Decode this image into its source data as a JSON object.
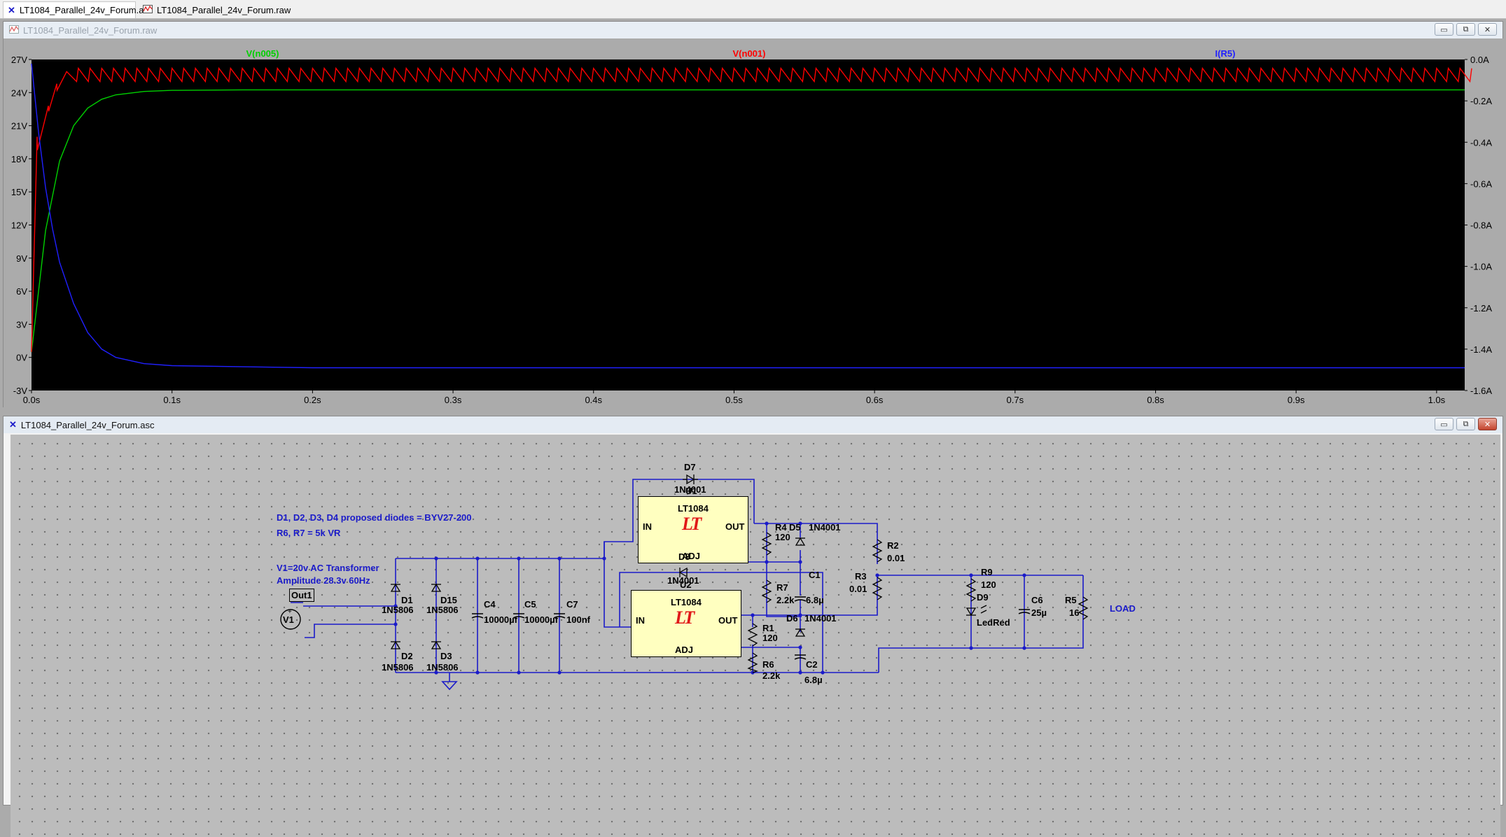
{
  "tabs": [
    {
      "label": "LT1084_Parallel_24v_Forum.asc",
      "icon": "schematic-icon",
      "active": true
    },
    {
      "label": "LT1084_Parallel_24v_Forum.raw",
      "icon": "waveform-icon",
      "active": false
    }
  ],
  "waveform_window": {
    "title": "LT1084_Parallel_24v_Forum.raw",
    "icon": "waveform-icon"
  },
  "schematic_window": {
    "title": "LT1084_Parallel_24v_Forum.asc",
    "icon": "schematic-icon"
  },
  "window_buttons": {
    "minimize": "▭",
    "restore": "⧉",
    "close": "✕"
  },
  "colors": {
    "plot_bg": "#000000",
    "v_n005": "#00d000",
    "v_n001": "#ff0000",
    "i_r5": "#2020ff",
    "wire": "#1b1bc9",
    "ic_fill": "#ffffc0"
  },
  "chart_data": {
    "type": "line",
    "title": "",
    "xlabel": "",
    "ylabel": "",
    "xlim": [
      0.0,
      1.02
    ],
    "ylim_left": [
      -3,
      27
    ],
    "ylim_right": [
      -1.6,
      0.0
    ],
    "x_ticks": [
      "0.0s",
      "0.1s",
      "0.2s",
      "0.3s",
      "0.4s",
      "0.5s",
      "0.6s",
      "0.7s",
      "0.8s",
      "0.9s",
      "1.0s"
    ],
    "x_tick_values": [
      0,
      0.1,
      0.2,
      0.3,
      0.4,
      0.5,
      0.6,
      0.7,
      0.8,
      0.9,
      1.0
    ],
    "left_ticks": [
      "27V",
      "24V",
      "21V",
      "18V",
      "15V",
      "12V",
      "9V",
      "6V",
      "3V",
      "0V",
      "-3V"
    ],
    "left_tick_values": [
      27,
      24,
      21,
      18,
      15,
      12,
      9,
      6,
      3,
      0,
      -3
    ],
    "right_ticks": [
      "0.0A",
      "-0.2A",
      "-0.4A",
      "-0.6A",
      "-0.8A",
      "-1.0A",
      "-1.2A",
      "-1.4A",
      "-1.6A"
    ],
    "right_tick_values": [
      0,
      -0.2,
      -0.4,
      -0.6,
      -0.8,
      -1.0,
      -1.2,
      -1.4,
      -1.6
    ],
    "grid": false,
    "series": [
      {
        "name": "V(n005)",
        "axis": "left",
        "color": "#00d000",
        "x": [
          0,
          0.01,
          0.02,
          0.03,
          0.04,
          0.05,
          0.06,
          0.08,
          0.1,
          0.15,
          1.02
        ],
        "y": [
          0.5,
          11.5,
          17.8,
          21.0,
          22.6,
          23.4,
          23.8,
          24.1,
          24.2,
          24.25,
          24.25
        ]
      },
      {
        "name": "V(n001)",
        "axis": "left",
        "color": "#ff0000",
        "envelope": {
          "start": [
            0,
            0.5
          ],
          "peak": 26.2,
          "trough": 25.0,
          "ripple_hz": 60,
          "first_points": [
            [
              0,
              0.5
            ],
            [
              0.004,
              20
            ],
            [
              0.0042,
              18.8
            ],
            [
              0.012,
              22.8
            ],
            [
              0.0122,
              22.3
            ],
            [
              0.018,
              24.8
            ],
            [
              0.0182,
              24.2
            ],
            [
              0.025,
              25.9
            ]
          ]
        }
      },
      {
        "name": "I(R5)",
        "axis": "right",
        "color": "#2020ff",
        "x": [
          0,
          0.005,
          0.01,
          0.015,
          0.02,
          0.03,
          0.04,
          0.05,
          0.06,
          0.08,
          0.1,
          0.2,
          1.02
        ],
        "y": [
          -0.02,
          -0.35,
          -0.62,
          -0.82,
          -0.98,
          -1.18,
          -1.32,
          -1.4,
          -1.44,
          -1.47,
          -1.48,
          -1.49,
          -1.49
        ]
      }
    ]
  },
  "schematic": {
    "notes": {
      "diodes": "D1, D2, D3, D4 proposed diodes = BYV27-200",
      "vr": "R6, R7 = 5k VR",
      "transformer": "V1=20v AC Transformer",
      "amplitude": "Amplitude 28.3v 60Hz"
    },
    "label_out1": "Out1",
    "label_load": "LOAD",
    "u1": {
      "ref": "U1",
      "part": "LT1084",
      "in": "IN",
      "out": "OUT",
      "adj": "ADJ"
    },
    "u2": {
      "ref": "U2",
      "part": "LT1084",
      "in": "IN",
      "out": "OUT",
      "adj": "ADJ"
    },
    "logo_text": "LT",
    "components": [
      {
        "ref": "D7",
        "value": "1N4001"
      },
      {
        "ref": "D8",
        "value": "1N4001"
      },
      {
        "ref": "D5",
        "value": "1N4001"
      },
      {
        "ref": "D6",
        "value": "1N4001"
      },
      {
        "ref": "R4",
        "value": "120"
      },
      {
        "ref": "R7",
        "value": "2.2k"
      },
      {
        "ref": "C1",
        "value": "6.8µ"
      },
      {
        "ref": "R1",
        "value": "120"
      },
      {
        "ref": "R6",
        "value": "2.2k"
      },
      {
        "ref": "C2",
        "value": "6.8µ"
      },
      {
        "ref": "R2",
        "value": "0.01"
      },
      {
        "ref": "R3",
        "value": "0.01"
      },
      {
        "ref": "R9",
        "value": "120"
      },
      {
        "ref": "D9",
        "value": "LedRed"
      },
      {
        "ref": "C6",
        "value": "25µ"
      },
      {
        "ref": "R5",
        "value": "16"
      },
      {
        "ref": "D1",
        "value": "1N5806"
      },
      {
        "ref": "D15",
        "value": "1N5806"
      },
      {
        "ref": "D2",
        "value": "1N5806"
      },
      {
        "ref": "D3",
        "value": "1N5806"
      },
      {
        "ref": "C4",
        "value": "10000µf"
      },
      {
        "ref": "C5",
        "value": "10000µf"
      },
      {
        "ref": "C7",
        "value": "100nf"
      },
      {
        "ref": "V1",
        "value": ""
      }
    ]
  }
}
